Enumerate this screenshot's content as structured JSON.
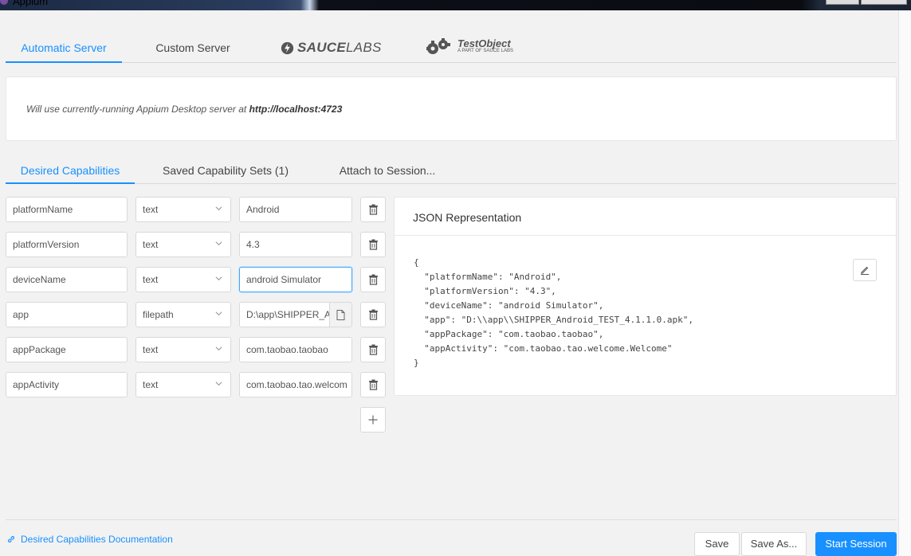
{
  "window": {
    "title": "Appium"
  },
  "server_tabs": {
    "automatic": "Automatic Server",
    "custom": "Custom Server",
    "saucelabs_brand": "SAUCE",
    "saucelabs_brand_light": "LABS",
    "testobject_brand": "TestObject",
    "testobject_sub": "A PART OF SAUCE LABS"
  },
  "info": {
    "text": "Will use currently-running Appium Desktop server at",
    "url": "http://localhost:4723"
  },
  "caps_tabs": {
    "desired": "Desired Capabilities",
    "saved": "Saved Capability Sets (1)",
    "attach": "Attach to Session..."
  },
  "capabilities": [
    {
      "name": "platformName",
      "type": "text",
      "value": "Android"
    },
    {
      "name": "platformVersion",
      "type": "text",
      "value": "4.3"
    },
    {
      "name": "deviceName",
      "type": "text",
      "value": "android Simulator"
    },
    {
      "name": "app",
      "type": "filepath",
      "value": "D:\\app\\SHIPPER_A"
    },
    {
      "name": "appPackage",
      "type": "text",
      "value": "com.taobao.taobao"
    },
    {
      "name": "appActivity",
      "type": "text",
      "value": "com.taobao.tao.welcom"
    }
  ],
  "json_panel": {
    "title": "JSON Representation",
    "body": "{\n  \"platformName\": \"Android\",\n  \"platformVersion\": \"4.3\",\n  \"deviceName\": \"android Simulator\",\n  \"app\": \"D:\\\\app\\\\SHIPPER_Android_TEST_4.1.1.0.apk\",\n  \"appPackage\": \"com.taobao.taobao\",\n  \"appActivity\": \"com.taobao.tao.welcome.Welcome\"\n}"
  },
  "footer": {
    "doc_link": "Desired Capabilities Documentation",
    "save": "Save",
    "save_as": "Save As...",
    "start": "Start Session"
  },
  "colors": {
    "accent": "#1890ff",
    "background": "#f2f2f2",
    "panel": "#ffffff"
  }
}
